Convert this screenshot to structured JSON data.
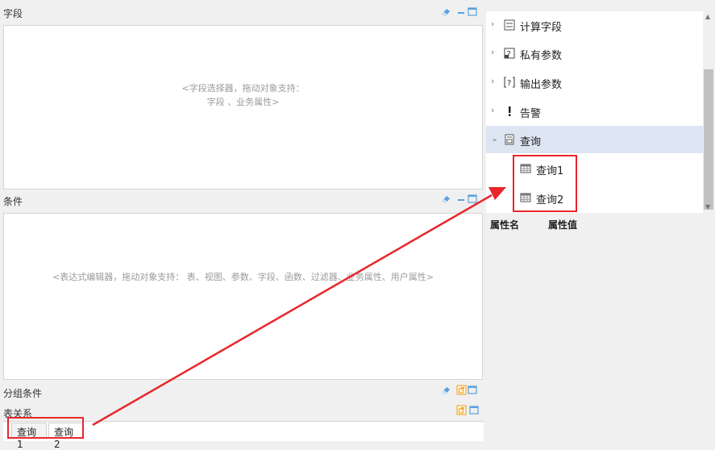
{
  "fields": {
    "title": "字段",
    "hint_line1": "<字段选择器，拖动对象支持：",
    "hint_line2": "字段 、业务属性>"
  },
  "conditions": {
    "title": "条件",
    "hint": "<表达式编辑器，拖动对象支持： 表、视图、参数、字段、函数、过滤器、业务属性、用户属性>"
  },
  "group_conditions": {
    "title": "分组条件"
  },
  "table_relation": {
    "title": "表关系",
    "tabs": [
      "查询1",
      "查询2"
    ]
  },
  "tree": {
    "items": [
      {
        "label": "计算字段",
        "icon": "calc-field-icon",
        "expanded": false
      },
      {
        "label": "私有参数",
        "icon": "private-param-icon",
        "expanded": false
      },
      {
        "label": "输出参数",
        "icon": "output-param-icon",
        "expanded": false
      },
      {
        "label": "告警",
        "icon": "alert-icon",
        "expanded": false
      },
      {
        "label": "查询",
        "icon": "query-icon",
        "expanded": true,
        "selected": true
      }
    ],
    "children": [
      {
        "label": "查询1",
        "icon": "table-icon"
      },
      {
        "label": "查询2",
        "icon": "table-icon"
      }
    ]
  },
  "properties": {
    "name_header": "属性名",
    "value_header": "属性值"
  },
  "colors": {
    "annotation": "#e8262b",
    "selected_row": "#dde5f2",
    "icon_blue": "#4a8fd8",
    "icon_orange": "#f0a11b"
  }
}
